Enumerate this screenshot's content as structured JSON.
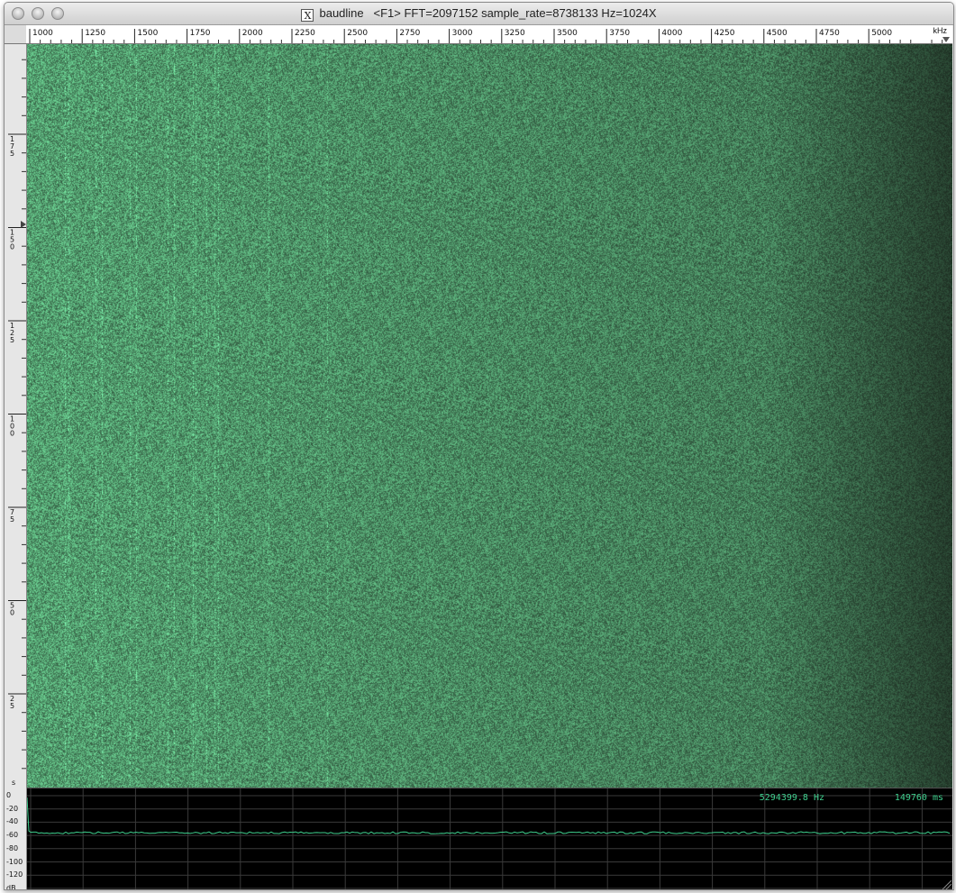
{
  "window": {
    "title": "baudline   <F1> FFT=2097152 sample_rate=8738133 Hz=1024X",
    "icon": "x11-icon"
  },
  "frequency_ruler": {
    "ticks": [
      "1000",
      "1250",
      "1500",
      "1750",
      "2000",
      "2250",
      "2500",
      "2750",
      "3000",
      "3250",
      "3500",
      "3750",
      "4000",
      "4250",
      "4500",
      "4750",
      "5000"
    ],
    "unit": "kHz"
  },
  "time_ruler": {
    "labels": [
      "175",
      "150",
      "125",
      "100",
      "75",
      "50",
      "25"
    ],
    "unit": "s"
  },
  "spectrum_scope": {
    "db_labels": [
      "0",
      "-20",
      "-40",
      "-60",
      "-80",
      "-100",
      "-120",
      "dB"
    ],
    "frequency_readout": "5294399.8 Hz",
    "time_readout": "149760 ms",
    "trace_level_db": -56
  },
  "colors": {
    "spectrogram_green": "#1f7d62",
    "trace_green": "#3fcf8e",
    "grid": "#3a3a3a"
  }
}
